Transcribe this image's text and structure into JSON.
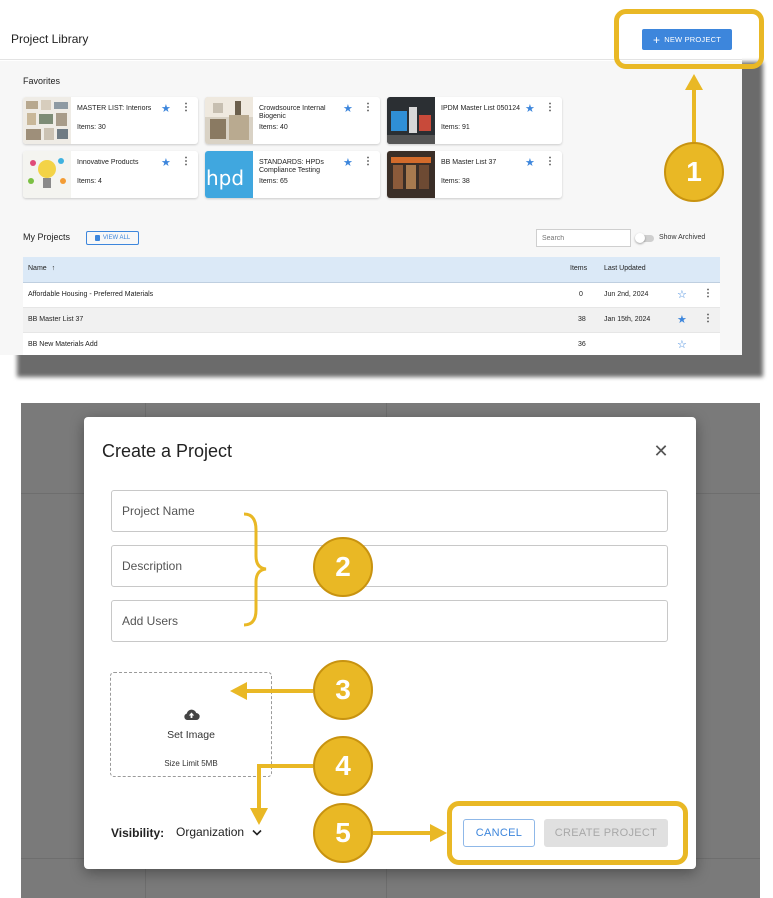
{
  "library": {
    "title": "Project Library",
    "new_project_label": "NEW PROJECT",
    "favorites_title": "Favorites",
    "favorites": [
      {
        "name": "MASTER LIST: Interiors",
        "items": "Items: 30"
      },
      {
        "name": "Crowdsource Internal Biogenic",
        "items": "Items: 40"
      },
      {
        "name": "IPDM Master List 050124",
        "items": "Items: 91"
      },
      {
        "name": "Innovative Products",
        "items": "Items: 4"
      },
      {
        "name": "STANDARDS: HPDs Compliance Testing",
        "items": "Items: 65"
      },
      {
        "name": "BB Master List 37",
        "items": "Items: 38"
      }
    ],
    "my_projects_title": "My Projects",
    "view_all_label": "VIEW ALL",
    "search_placeholder": "Search",
    "show_archived_label": "Show Archived",
    "table": {
      "headers": {
        "name": "Name",
        "items": "Items",
        "last_updated": "Last Updated"
      },
      "rows": [
        {
          "name": "Affordable Housing - Preferred Materials",
          "items": "0",
          "last_updated": "Jun 2nd, 2024",
          "starred": false
        },
        {
          "name": "BB Master List 37",
          "items": "38",
          "last_updated": "Jan 15th, 2024",
          "starred": true
        },
        {
          "name": "BB New Materials Add",
          "items": "36",
          "last_updated": "",
          "starred": false
        }
      ]
    }
  },
  "dialog": {
    "title": "Create a Project",
    "project_name_placeholder": "Project Name",
    "description_placeholder": "Description",
    "add_users_placeholder": "Add Users",
    "set_image_label": "Set Image",
    "size_limit_label": "Size Limit 5MB",
    "visibility_label": "Visibility:",
    "visibility_value": "Organization",
    "cancel_label": "CANCEL",
    "create_label": "CREATE PROJECT"
  },
  "callouts": {
    "step1": "1",
    "step2": "2",
    "step3": "3",
    "step4": "4",
    "step5": "5"
  },
  "colors": {
    "accent": "#3d86dc",
    "callout": "#e9b825",
    "table_header": "#dbe9f7"
  },
  "icons": {
    "plus": "plus-icon",
    "star": "star-icon",
    "kebab": "kebab-menu-icon",
    "sort": "sort-arrow-up-icon",
    "close": "close-icon",
    "upload": "cloud-upload-icon",
    "chevron": "chevron-down-icon"
  }
}
